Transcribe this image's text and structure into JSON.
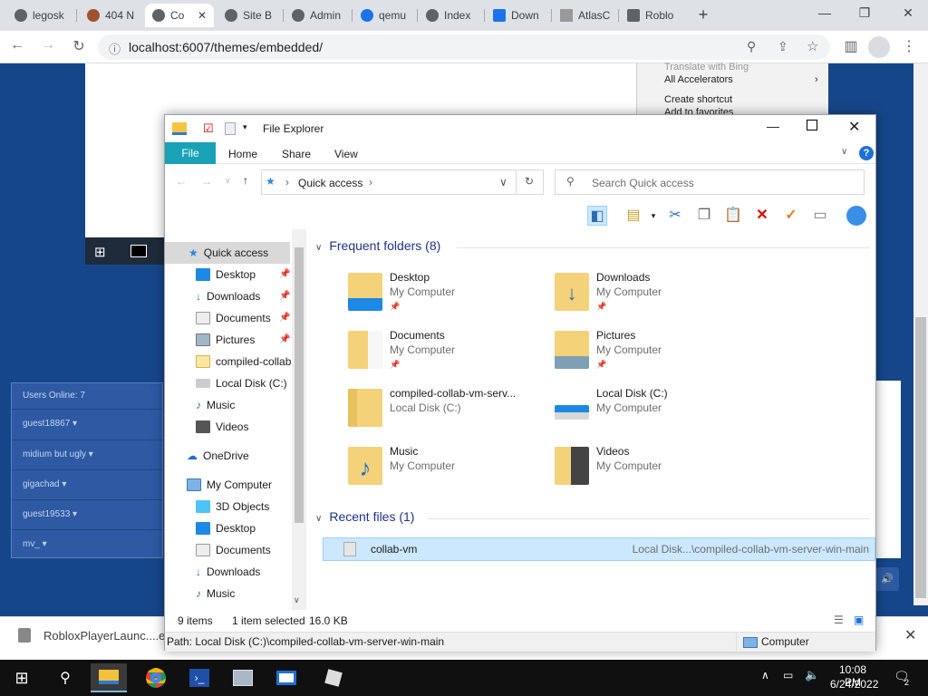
{
  "browser": {
    "tabs": [
      {
        "label": "legosk",
        "icon": "github-icon"
      },
      {
        "label": "404 N",
        "icon": "avatar-icon"
      },
      {
        "label": "Co",
        "icon": "globe-icon"
      },
      {
        "label": "Site B",
        "icon": "globe-icon"
      },
      {
        "label": "Admin",
        "icon": "globe-icon"
      },
      {
        "label": "qemu",
        "icon": "search-icon"
      },
      {
        "label": "Index",
        "icon": "github-icon"
      },
      {
        "label": "Down",
        "icon": "download-icon"
      },
      {
        "label": "AtlasC",
        "icon": "triangle-icon"
      },
      {
        "label": "Roblo",
        "icon": "roblox-icon"
      }
    ],
    "new_tab": "+",
    "url": "localhost:6007/themes/embedded/"
  },
  "context_menu": {
    "items": [
      "Translate with Bing",
      "All Accelerators",
      "Create shortcut",
      "Add to favorites"
    ]
  },
  "users_panel": {
    "header": "Users Online: 7",
    "users": [
      "guest18867",
      "midium but ugly",
      "gigachad",
      "guest19533",
      "mv_"
    ]
  },
  "download_shelf": {
    "file": "RobloxPlayerLaunc....exe"
  },
  "explorer": {
    "title": "File Explorer",
    "ribbon": [
      "File",
      "Home",
      "Share",
      "View"
    ],
    "address": {
      "root": "Quick access"
    },
    "search_placeholder": "Search Quick access",
    "nav": [
      {
        "label": "Quick access",
        "icon": "star-icon",
        "level": 0,
        "selected": true
      },
      {
        "label": "Desktop",
        "icon": "desktop-icon",
        "level": 1,
        "pinned": true
      },
      {
        "label": "Downloads",
        "icon": "download-arrow-icon",
        "level": 1,
        "pinned": true
      },
      {
        "label": "Documents",
        "icon": "documents-icon",
        "level": 1,
        "pinned": true
      },
      {
        "label": "Pictures",
        "icon": "pictures-icon",
        "level": 1,
        "pinned": true
      },
      {
        "label": "compiled-collab",
        "icon": "folder-icon",
        "level": 1
      },
      {
        "label": "Local Disk (C:)",
        "icon": "disk-icon",
        "level": 1
      },
      {
        "label": "Music",
        "icon": "music-icon",
        "level": 1
      },
      {
        "label": "Videos",
        "icon": "videos-icon",
        "level": 1
      },
      {
        "label": "OneDrive",
        "icon": "cloud-icon",
        "level": 0
      },
      {
        "label": "My Computer",
        "icon": "computer-icon",
        "level": 0
      },
      {
        "label": "3D Objects",
        "icon": "cube-icon",
        "level": 1
      },
      {
        "label": "Desktop",
        "icon": "desktop-icon",
        "level": 1
      },
      {
        "label": "Documents",
        "icon": "documents-icon",
        "level": 1
      },
      {
        "label": "Downloads",
        "icon": "download-arrow-icon",
        "level": 1
      },
      {
        "label": "Music",
        "icon": "music-icon",
        "level": 1
      }
    ],
    "frequent_header": "Frequent folders (8)",
    "folders": [
      {
        "name": "Desktop",
        "location": "My Computer",
        "pinned": true
      },
      {
        "name": "Downloads",
        "location": "My Computer",
        "pinned": true
      },
      {
        "name": "Documents",
        "location": "My Computer",
        "pinned": true
      },
      {
        "name": "Pictures",
        "location": "My Computer",
        "pinned": true
      },
      {
        "name": "compiled-collab-vm-serv...",
        "location": "Local Disk (C:)",
        "pinned": false
      },
      {
        "name": "Local Disk (C:)",
        "location": "My Computer",
        "pinned": false
      },
      {
        "name": "Music",
        "location": "My Computer",
        "pinned": false
      },
      {
        "name": "Videos",
        "location": "My Computer",
        "pinned": false
      }
    ],
    "recent_header": "Recent files (1)",
    "recent": [
      {
        "name": "collab-vm",
        "path": "Local Disk...\\compiled-collab-vm-server-win-main"
      }
    ],
    "status": {
      "items": "9 items",
      "selected": "1 item selected",
      "size": "16.0 KB"
    },
    "path_bar": {
      "path": "Path: Local Disk (C:)\\compiled-collab-vm-server-win-main",
      "zone": "Computer"
    }
  },
  "taskbar": {
    "time": "10:08 PM",
    "date": "6/24/2022",
    "notifications": "2"
  },
  "colors": {
    "page_blue": "#16468a",
    "file_tab": "#19a1b5",
    "selection": "#cce8ff",
    "taskbar": "#101010"
  }
}
